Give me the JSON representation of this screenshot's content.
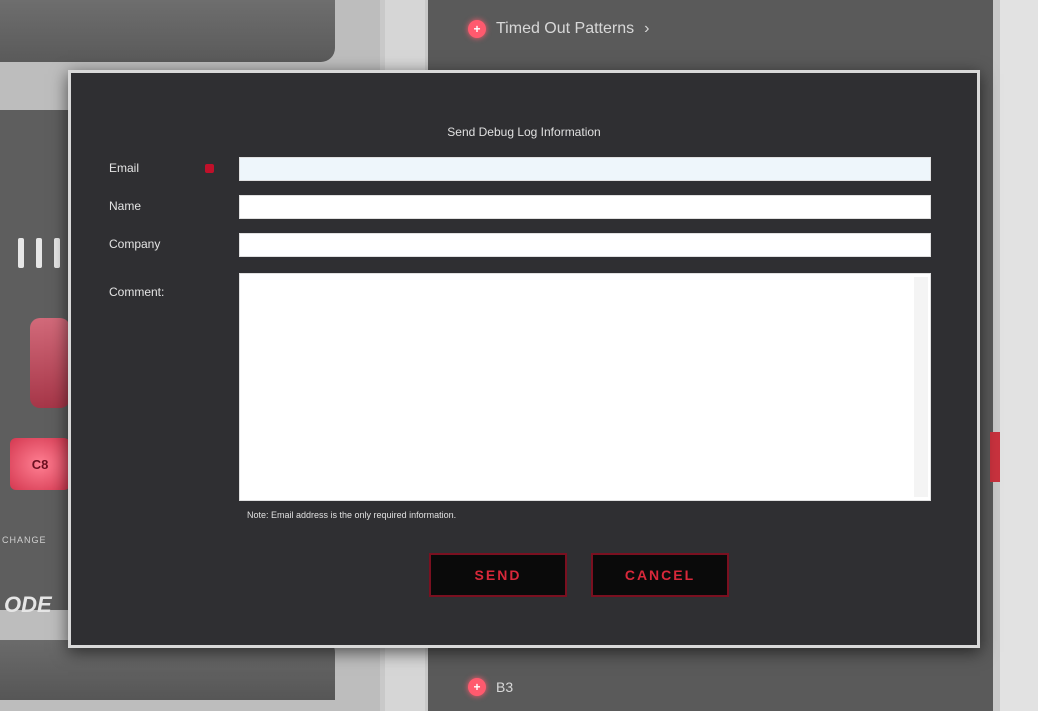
{
  "background": {
    "header_label": "Timed Out Patterns",
    "header_chevron": "›",
    "footer_label": "B3",
    "left_button_label": "C8",
    "mode_text": "ODE",
    "change_text": "CHANGE"
  },
  "dialog": {
    "title": "Send Debug Log Information",
    "fields": {
      "email_label": "Email",
      "name_label": "Name",
      "company_label": "Company",
      "comment_label": "Comment:",
      "email_value": "",
      "name_value": "",
      "company_value": "",
      "comment_value": ""
    },
    "note": "Note: Email address is the only required information.",
    "send_label": "SEND",
    "cancel_label": "CANCEL"
  },
  "colors": {
    "accent": "#d8283a",
    "dialog_bg": "#2f2f32",
    "required": "#c0102a"
  }
}
